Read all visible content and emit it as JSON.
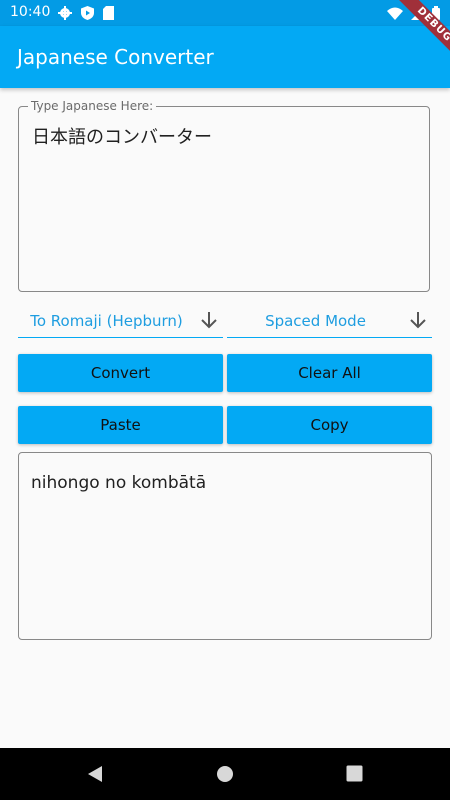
{
  "status_bar": {
    "time": "10:40",
    "left_icons": [
      "gear-icon",
      "play-protect-icon",
      "sd-card-icon"
    ],
    "right_icons": [
      "wifi-icon",
      "signal-icon",
      "battery-icon"
    ]
  },
  "app_bar": {
    "title": "Japanese Converter"
  },
  "debug_banner": "DEBUG",
  "input": {
    "label": "Type Japanese Here:",
    "value": "日本語のコンバーター"
  },
  "dropdowns": {
    "mode": {
      "value": "To Romaji (Hepburn)"
    },
    "spacing": {
      "value": "Spaced Mode"
    }
  },
  "buttons": {
    "convert": "Convert",
    "clear_all": "Clear All",
    "paste": "Paste",
    "copy": "Copy"
  },
  "output": {
    "value": "nihongo no kombātā"
  },
  "colors": {
    "primary": "#03a9f4",
    "status_bar": "#039be5",
    "background": "#fafafa",
    "debug_banner": "#a0303a"
  }
}
